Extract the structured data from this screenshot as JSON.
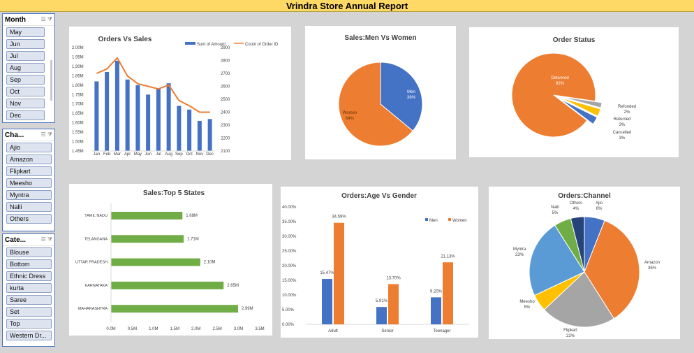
{
  "header": {
    "title": "Vrindra Store Annual Report"
  },
  "slicers": [
    {
      "title": "Month",
      "items": [
        "May",
        "Jun",
        "Jul",
        "Aug",
        "Sep",
        "Oct",
        "Nov",
        "Dec"
      ]
    },
    {
      "title": "Cha...",
      "items": [
        "Ajio",
        "Amazon",
        "Flipkart",
        "Meesho",
        "Myntra",
        "Nalli",
        "Others"
      ]
    },
    {
      "title": "Cate...",
      "items": [
        "Blouse",
        "Bottom",
        "Ethnic Dress",
        "kurta",
        "Saree",
        "Set",
        "Top",
        "Western Dr..."
      ]
    }
  ],
  "icons": {
    "multiselect": "multi-select-icon",
    "clear_filter": "clear-filter-icon"
  },
  "chart_data": [
    {
      "id": "orders_vs_sales",
      "type": "bar",
      "title": "Orders Vs Sales",
      "categories": [
        "Jan",
        "Feb",
        "Mar",
        "Apr",
        "May",
        "Jun",
        "Jul",
        "Aug",
        "Sep",
        "Oct",
        "Nov",
        "Dec"
      ],
      "series": [
        {
          "name": "Sum of Amount",
          "type": "bar",
          "axis": "left",
          "color": "#4472c4",
          "values": [
            1.82,
            1.87,
            1.93,
            1.83,
            1.8,
            1.75,
            1.78,
            1.81,
            1.69,
            1.67,
            1.61,
            1.62
          ]
        },
        {
          "name": "Count of Order ID",
          "type": "line",
          "axis": "right",
          "color": "#ed7d31",
          "values": [
            2700,
            2735,
            2820,
            2680,
            2620,
            2600,
            2580,
            2610,
            2490,
            2450,
            2400,
            2400
          ]
        }
      ],
      "yleft": {
        "ticks": [
          "1.45M",
          "1.50M",
          "1.55M",
          "1.60M",
          "1.65M",
          "1.70M",
          "1.75M",
          "1.80M",
          "1.85M",
          "1.90M",
          "1.95M",
          "2.00M"
        ],
        "min": 1.45,
        "max": 2.0
      },
      "yright": {
        "ticks": [
          "2100",
          "2200",
          "2300",
          "2400",
          "2500",
          "2600",
          "2700",
          "2800",
          "2900"
        ],
        "min": 2100,
        "max": 2900
      },
      "legend": "top-right"
    },
    {
      "id": "men_vs_women",
      "type": "pie",
      "title": "Sales:Men Vs Women",
      "slices": [
        {
          "label": "Men",
          "value": 36,
          "text": "36%",
          "color": "#4472c4"
        },
        {
          "label": "Women",
          "value": 64,
          "text": "64%",
          "color": "#ed7d31"
        }
      ]
    },
    {
      "id": "order_status",
      "type": "pie",
      "title": "Order Status",
      "slices": [
        {
          "label": "Delivered",
          "value": 92,
          "text": "92%",
          "color": "#ed7d31"
        },
        {
          "label": "Refunded",
          "value": 2,
          "text": "2%",
          "color": "#a5a5a5"
        },
        {
          "label": "Returned",
          "value": 3,
          "text": "3%",
          "color": "#ffc000"
        },
        {
          "label": "Cancelled",
          "value": 3,
          "text": "3%",
          "color": "#4472c4"
        }
      ]
    },
    {
      "id": "top_states",
      "type": "bar",
      "orientation": "horizontal",
      "title": "Sales:Top 5 States",
      "categories": [
        "TAMIL NADU",
        "TELANGANA",
        "UTTAR PRADESH",
        "KARNATAKA",
        "MAHARASHTRA"
      ],
      "values": [
        1.68,
        1.71,
        2.1,
        2.65,
        2.99
      ],
      "value_labels": [
        "1.68M",
        "1.71M",
        "2.10M",
        "2.65M",
        "2.99M"
      ],
      "color": "#70ad47",
      "x_ticks": [
        "0.0M",
        "0.5M",
        "1.0M",
        "1.5M",
        "2.0M",
        "2.5M",
        "3.0M",
        "3.5M"
      ],
      "xlim": [
        0,
        3.5
      ]
    },
    {
      "id": "age_vs_gender",
      "type": "bar",
      "title": "Orders:Age Vs Gender",
      "categories": [
        "Adult",
        "Senior",
        "Teenager"
      ],
      "series": [
        {
          "name": "Men",
          "color": "#4472c4",
          "values": [
            15.47,
            5.91,
            9.2
          ],
          "labels": [
            "15.47%",
            "5.91%",
            "9.20%"
          ]
        },
        {
          "name": "Women",
          "color": "#ed7d31",
          "values": [
            34.59,
            13.7,
            21.13
          ],
          "labels": [
            "34.59%",
            "13.70%",
            "21.13%"
          ]
        }
      ],
      "y_ticks": [
        "0.00%",
        "5.00%",
        "10.00%",
        "15.00%",
        "20.00%",
        "25.00%",
        "30.00%",
        "35.00%",
        "40.00%"
      ],
      "ylim": [
        0,
        40
      ],
      "legend": "top-right"
    },
    {
      "id": "orders_channel",
      "type": "pie",
      "title": "Orders:Channel",
      "slices": [
        {
          "label": "Ajio",
          "value": 6,
          "text": "6%",
          "color": "#4472c4"
        },
        {
          "label": "Amazon",
          "value": 35,
          "text": "35%",
          "color": "#ed7d31"
        },
        {
          "label": "Flipkart",
          "value": 22,
          "text": "22%",
          "color": "#a5a5a5"
        },
        {
          "label": "Meesho",
          "value": 5,
          "text": "5%",
          "color": "#ffc000"
        },
        {
          "label": "Myntra",
          "value": 23,
          "text": "23%",
          "color": "#5b9bd5"
        },
        {
          "label": "Nalli",
          "value": 5,
          "text": "5%",
          "color": "#70ad47"
        },
        {
          "label": "Others",
          "value": 4,
          "text": "4%",
          "color": "#264478"
        }
      ]
    }
  ]
}
